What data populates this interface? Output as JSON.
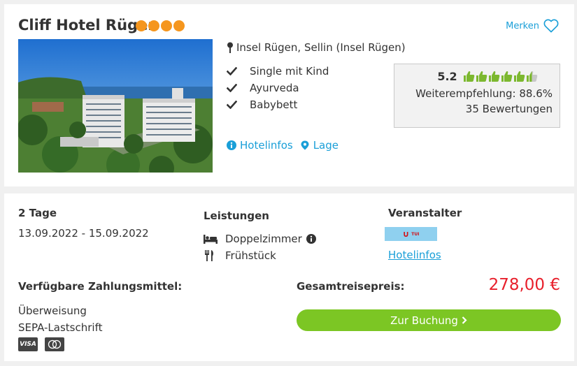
{
  "hotel": {
    "name": "Cliff Hotel Rügen",
    "star_count": 4,
    "star_color": "#f5961e",
    "location": "Insel Rügen, Sellin (Insel Rügen)",
    "features": [
      "Single mit Kind",
      "Ayurveda",
      "Babybett"
    ],
    "links": {
      "hotelinfos": "Hotelinfos",
      "lage": "Lage"
    },
    "merken_label": "Merken"
  },
  "rating": {
    "score": "5.2",
    "thumbs_filled": 5.5,
    "thumbs_total": 6,
    "recommendation": "Weiterempfehlung: 88.6%",
    "reviews": "35 Bewertungen"
  },
  "offer": {
    "days": "2 Tage",
    "dates": "13.09.2022 - 15.09.2022",
    "services_heading": "Leistungen",
    "services": [
      "Doppelzimmer",
      "Frühstück"
    ],
    "operator_heading": "Veranstalter",
    "operator_logo_text": "TUI",
    "operator_link": "Hotelinfos",
    "payment_heading": "Verfügbare Zahlungsmittel:",
    "payment_methods": [
      "Überweisung",
      "SEPA-Lastschrift"
    ],
    "card_icons": [
      "VISA",
      "mastercard"
    ],
    "total_label": "Gesamtreisepreis:",
    "total_price": "278,00 €",
    "booking_button": "Zur Buchung"
  },
  "colors": {
    "accent_blue": "#1a9fd8",
    "thumb_green": "#7cb82f",
    "price_red": "#e8202c",
    "button_green": "#7cc624"
  },
  "icons": {
    "heart": "heart-icon",
    "map_pin": "map-pin-icon",
    "check": "check-icon",
    "info": "info-icon",
    "location": "location-marker-icon",
    "bed": "bed-icon",
    "cutlery": "cutlery-icon",
    "chevron": "chevron-right-icon"
  }
}
